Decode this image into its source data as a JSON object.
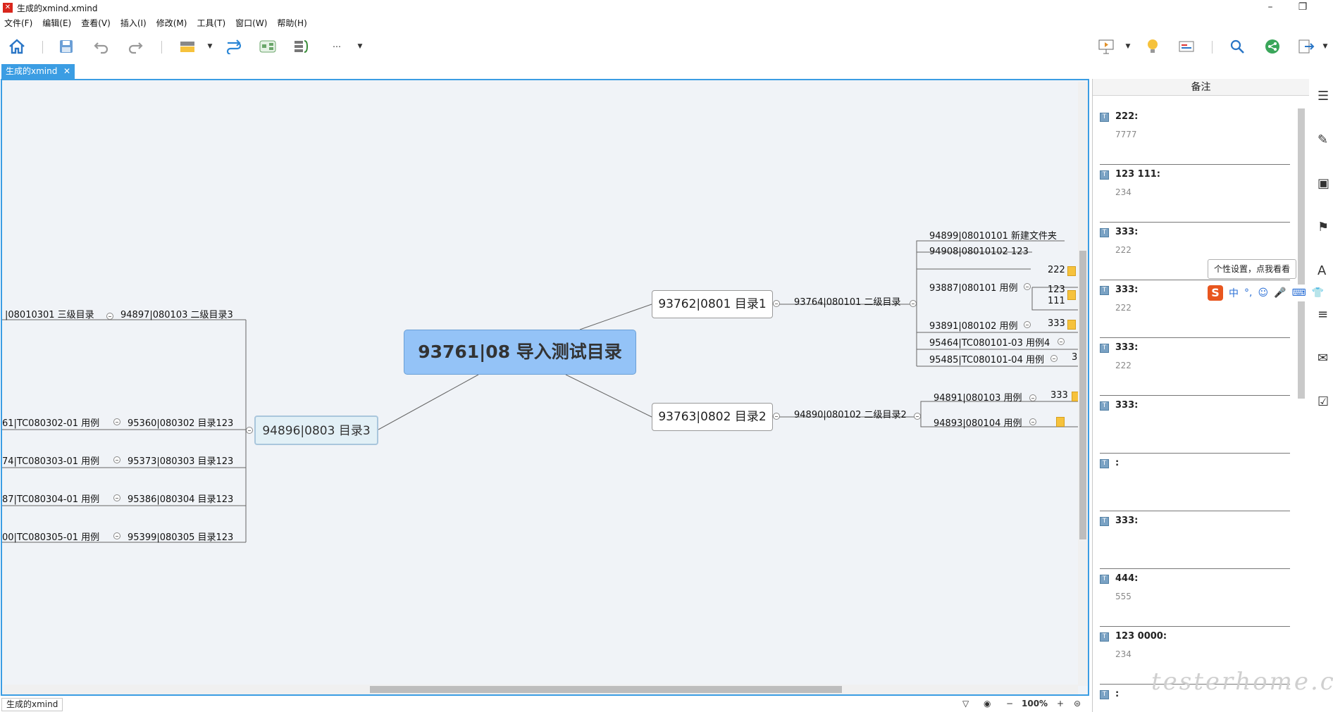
{
  "window": {
    "title": "生成的xmind.xmind",
    "minimize": "–",
    "restore": "❐"
  },
  "menu": [
    "文件(F)",
    "编辑(E)",
    "查看(V)",
    "插入(I)",
    "修改(M)",
    "工具(T)",
    "窗口(W)",
    "帮助(H)"
  ],
  "toolbar": {
    "more": "⋯"
  },
  "tab": {
    "label": "生成的xmind",
    "close": "✕"
  },
  "mindmap": {
    "central": "93761|08 导入测试目录",
    "nodes": {
      "n1": "93762|0801 目录1",
      "n2": "93763|0802 目录2",
      "n3": "94896|0803 目录3"
    },
    "topics": {
      "t_94897": "94897|080103 二级目录3",
      "t_080103_01": "|08010301 三级目录",
      "t_94764": "93764|080101 二级目录",
      "t_94899": "94899|08010101 新建文件夹",
      "t_94908": "94908|08010102 123",
      "t_93887": "93887|080101 用例",
      "t_93891": "93891|080102 用例",
      "t_95464": "95464|TC080101-03 用例4",
      "t_95485": "95485|TC080101-04 用例",
      "t_94890": "94890|080102 二级目录2",
      "t_94891": "94891|080103 用例",
      "t_94893": "94893|080104 用例",
      "t_95360": "95360|080302 目录123",
      "t_95373": "95373|080303 目录123",
      "t_95386": "95386|080304 目录123",
      "t_95399": "95399|080305 目录123",
      "t_tc302": "61|TC080302-01 用例",
      "t_tc303": "74|TC080303-01 用例",
      "t_tc304": "87|TC080304-01 用例",
      "t_tc305": "00|TC080305-01 用例",
      "lbl_222": "222",
      "lbl_123": "123",
      "lbl_111": "111",
      "lbl_333a": "333",
      "lbl_333b": "333",
      "lbl_3": "3"
    }
  },
  "notes": {
    "header": "备注",
    "entries": [
      {
        "title": "222:",
        "body": "7777"
      },
      {
        "title": "123 111:",
        "body": "234"
      },
      {
        "title": "333:",
        "body": "222"
      },
      {
        "title": "333:",
        "body": "222"
      },
      {
        "title": "333:",
        "body": "222"
      },
      {
        "title": "333:",
        "body": ""
      },
      {
        "title": ":",
        "body": ""
      },
      {
        "title": "333:",
        "body": ""
      },
      {
        "title": "444:",
        "body": "555"
      },
      {
        "title": "123 0000:",
        "body": "234"
      },
      {
        "title": ":",
        "body": ""
      }
    ]
  },
  "ime": {
    "tooltip": "个性设置，点我看看",
    "logo": "S",
    "mode": "中",
    "punct": "°,"
  },
  "status": {
    "tab": "生成的xmind",
    "zoom": "100%",
    "minus": "−",
    "plus": "+"
  },
  "watermark": "testerhome.com",
  "colors": {
    "accent": "#3b9de3",
    "central": "#94c3f7",
    "canvas": "#f0f3f7",
    "note": "#f6c23c"
  }
}
